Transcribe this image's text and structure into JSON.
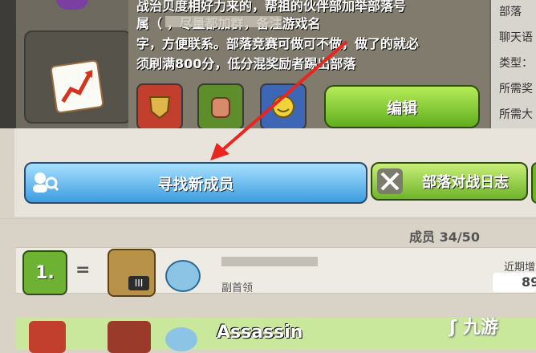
{
  "clan_description": {
    "line1": "战治贝度相好力来的，帮祖的伙伴部加举部落号",
    "line2": "属（       ，尽量都加群，备注游戏名",
    "line3": "字，方便联系。部落竞赛可做可不做，做了的就必",
    "line4": "须刷满800分，低分混奖励者踢出部落"
  },
  "clan_badges": [
    {
      "icon": "shield-badge-icon",
      "color": "#c23f2d"
    },
    {
      "icon": "fist-badge-icon",
      "color": "#5e8d2b"
    },
    {
      "icon": "smile-badge-icon",
      "color": "#3d66b5"
    }
  ],
  "buttons": {
    "edit": "编辑",
    "find_members": "寻找新成员",
    "war_log": "部落对战日志"
  },
  "side_info": {
    "items": [
      "部落",
      "聊天语",
      "类型：",
      "所需奖",
      "所需大"
    ]
  },
  "members": {
    "count_label": "成员 34/50",
    "rows": [
      {
        "rank": "1.",
        "change": "=",
        "th_level": "III",
        "role": "副首领",
        "recent_label": "近期增",
        "recent_value": "89"
      },
      {
        "name": "Assassin"
      }
    ]
  },
  "watermark": "九游",
  "accent": {
    "arrow": "#e8261f"
  }
}
